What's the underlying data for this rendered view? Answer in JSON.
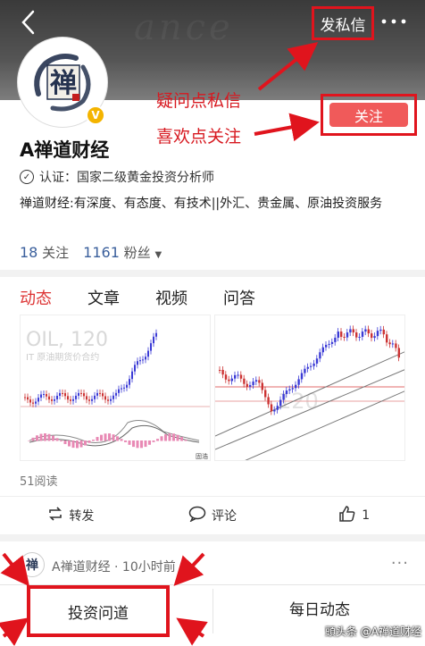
{
  "header": {
    "private_message_label": "发私信",
    "more_icon": "more-dots-icon",
    "back_icon": "back-arrow-icon"
  },
  "profile": {
    "avatar_glyph": "禅",
    "verified_badge": "V",
    "name": "A禅道财经",
    "certification": "认证：国家二级黄金投资分析师",
    "description": "禅道财经:有深度、有态度、有技术||外汇、贵金属、原油投资服务",
    "following_count": "18",
    "following_label": "关注",
    "followers_count": "1161",
    "followers_label": "粉丝",
    "follow_button": "关注"
  },
  "annotations": {
    "question_pm": "疑问点私信",
    "like_follow": "喜欢点关注",
    "color": "#d71920"
  },
  "tabs": [
    {
      "label": "动态",
      "active": true
    },
    {
      "label": "文章",
      "active": false
    },
    {
      "label": "视频",
      "active": false
    },
    {
      "label": "问答",
      "active": false
    }
  ],
  "thumbnails": {
    "left_overlay_text": "OIL, 120",
    "left_caption": "IT 原油期货价合约",
    "left_corner": "固浩",
    "right_overlay_text": "120"
  },
  "post": {
    "reads": "51阅读",
    "repost_label": "转发",
    "comment_label": "评论",
    "like_count": "1"
  },
  "post2": {
    "avatar_glyph": "禅",
    "author": "A禅道财经 · 10小时前",
    "more": "···"
  },
  "bottom_bar": {
    "left_label": "投资问道",
    "right_label": "每日动态",
    "watermark": "頭头条 @A禅道财经"
  },
  "colors": {
    "accent_red": "#e0141d",
    "follow_button": "#f05a5a",
    "link_blue": "#3a5f9c"
  }
}
